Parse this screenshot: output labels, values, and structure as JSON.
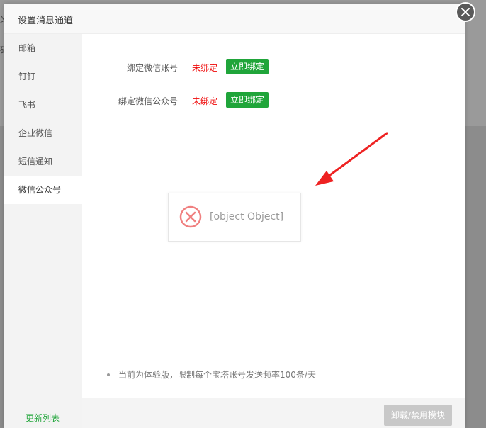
{
  "background": {
    "glyph_top": "义",
    "glyph_mid": "础"
  },
  "dialog": {
    "title": "设置消息通道"
  },
  "sidebar": {
    "items": [
      {
        "label": "邮箱",
        "active": false
      },
      {
        "label": "钉钉",
        "active": false
      },
      {
        "label": "飞书",
        "active": false
      },
      {
        "label": "企业微信",
        "active": false
      },
      {
        "label": "短信通知",
        "active": false
      },
      {
        "label": "微信公众号",
        "active": true
      }
    ],
    "footer_link": "更新列表"
  },
  "content": {
    "rows": [
      {
        "label": "绑定微信账号",
        "status": "未绑定",
        "button": "立即绑定"
      },
      {
        "label": "绑定微信公众号",
        "status": "未绑定",
        "button": "立即绑定"
      }
    ],
    "error_message": "[object Object]",
    "note": "当前为体验版，限制每个宝塔账号发送频率100条/天"
  },
  "footer": {
    "button": "卸载/禁用模块"
  },
  "colors": {
    "accent": "#20a53a",
    "status_unbound": "#ef0808",
    "annotation_arrow": "#ee2222",
    "error_icon": "#f08080"
  }
}
